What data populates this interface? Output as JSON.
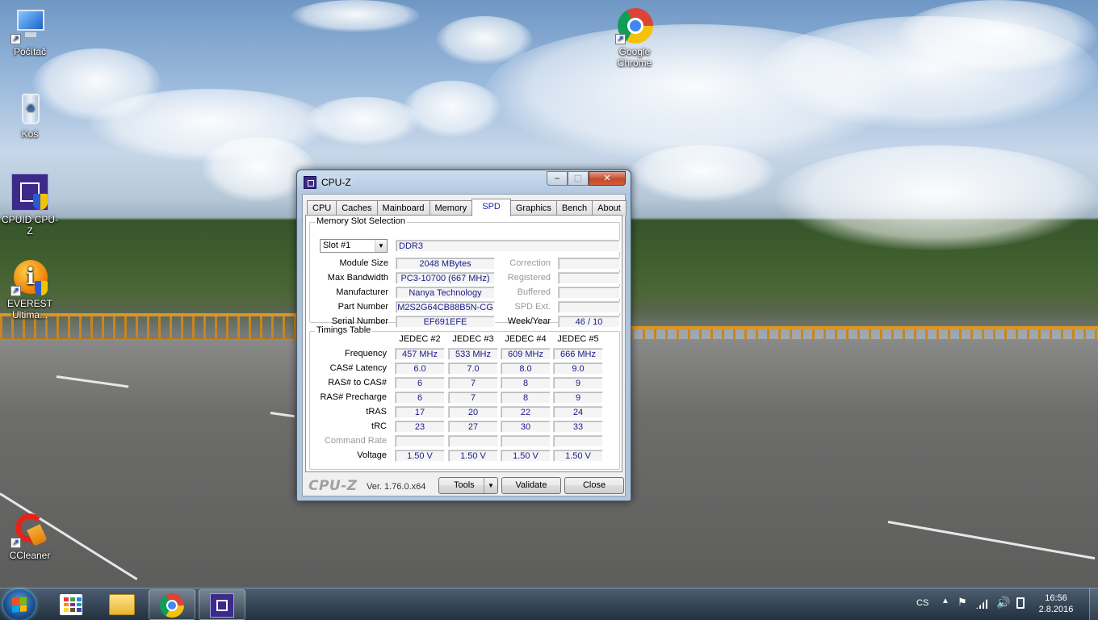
{
  "desktop": {
    "icons": [
      {
        "label": "Počítač",
        "icon": "computer-icon"
      },
      {
        "label": "Koš",
        "icon": "recycle-bin-icon"
      },
      {
        "label": "CPUID CPU-Z",
        "icon": "cpuz-icon"
      },
      {
        "label": "EVEREST Ultima...",
        "icon": "everest-icon"
      },
      {
        "label": "CCleaner",
        "icon": "ccleaner-icon"
      },
      {
        "label": "Google Chrome",
        "icon": "chrome-icon"
      }
    ]
  },
  "window": {
    "title": "CPU-Z",
    "caption_buttons": {
      "minimize": "‒",
      "maximize": "□",
      "close": "✕"
    },
    "tabs": [
      "CPU",
      "Caches",
      "Mainboard",
      "Memory",
      "SPD",
      "Graphics",
      "Bench",
      "About"
    ],
    "active_tab": "SPD",
    "memory_slot": {
      "group_title": "Memory Slot Selection",
      "slot_selected": "Slot #1",
      "type": "DDR3",
      "rows": [
        {
          "label": "Module Size",
          "value": "2048 MBytes",
          "rlabel": "Correction",
          "rvalue": ""
        },
        {
          "label": "Max Bandwidth",
          "value": "PC3-10700 (667 MHz)",
          "rlabel": "Registered",
          "rvalue": ""
        },
        {
          "label": "Manufacturer",
          "value": "Nanya Technology",
          "rlabel": "Buffered",
          "rvalue": ""
        },
        {
          "label": "Part Number",
          "value": "M2S2G64CB88B5N-CG",
          "rlabel": "SPD Ext.",
          "rvalue": ""
        },
        {
          "label": "Serial Number",
          "value": "EF691EFE",
          "rlabel": "Week/Year",
          "rvalue": "46 / 10"
        }
      ]
    },
    "timings": {
      "group_title": "Timings Table",
      "columns": [
        "JEDEC #2",
        "JEDEC #3",
        "JEDEC #4",
        "JEDEC #5"
      ],
      "rows": [
        {
          "label": "Frequency",
          "values": [
            "457 MHz",
            "533 MHz",
            "609 MHz",
            "666 MHz"
          ]
        },
        {
          "label": "CAS# Latency",
          "values": [
            "6.0",
            "7.0",
            "8.0",
            "9.0"
          ]
        },
        {
          "label": "RAS# to CAS#",
          "values": [
            "6",
            "7",
            "8",
            "9"
          ]
        },
        {
          "label": "RAS# Precharge",
          "values": [
            "6",
            "7",
            "8",
            "9"
          ]
        },
        {
          "label": "tRAS",
          "values": [
            "17",
            "20",
            "22",
            "24"
          ]
        },
        {
          "label": "tRC",
          "values": [
            "23",
            "27",
            "30",
            "33"
          ]
        },
        {
          "label": "Command Rate",
          "values": [
            "",
            "",
            "",
            ""
          ]
        },
        {
          "label": "Voltage",
          "values": [
            "1.50 V",
            "1.50 V",
            "1.50 V",
            "1.50 V"
          ]
        }
      ]
    },
    "footer": {
      "logo": "CPU-Z",
      "version": "Ver. 1.76.0.x64",
      "tools_label": "Tools",
      "validate_label": "Validate",
      "close_label": "Close"
    }
  },
  "taskbar": {
    "apps": [
      "metro-apps-icon",
      "explorer-icon",
      "chrome-icon",
      "cpuz-icon"
    ],
    "language": "CS",
    "time": "16:56",
    "date": "2.8.2016"
  }
}
